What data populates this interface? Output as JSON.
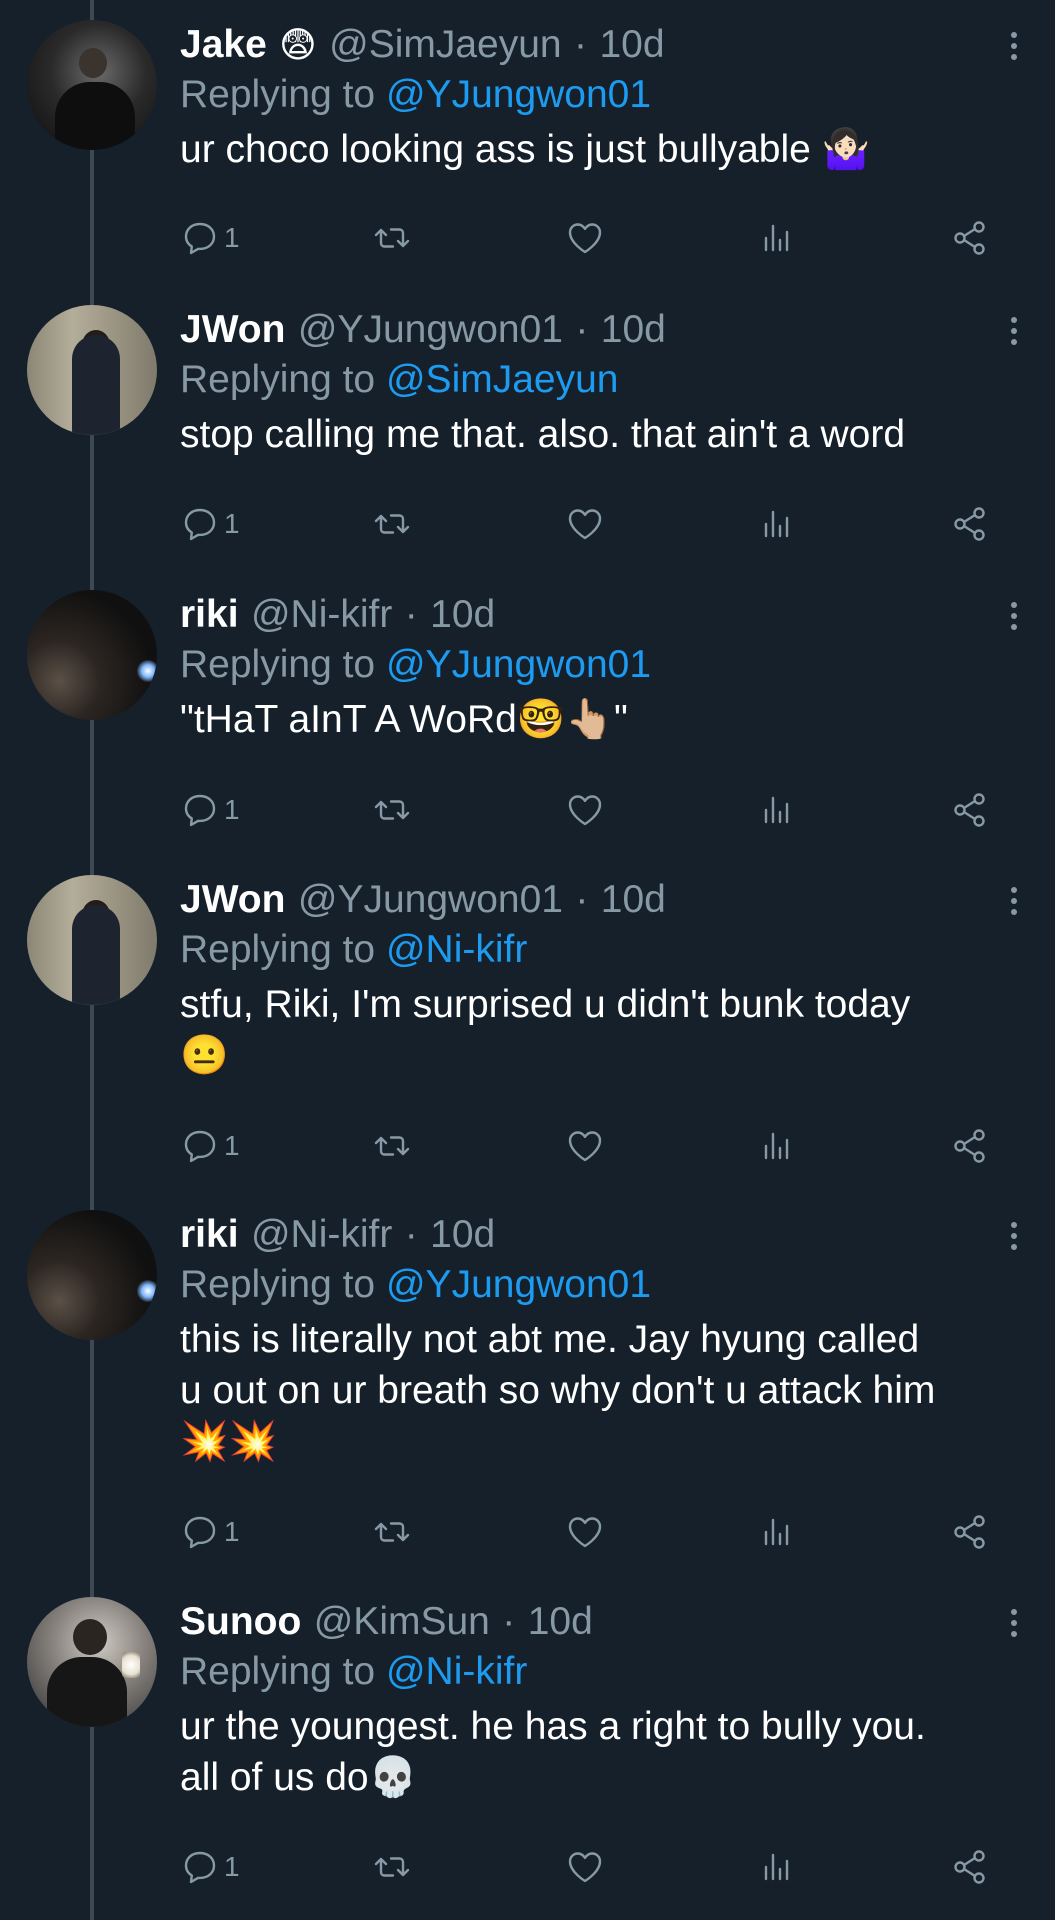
{
  "tweets": [
    {
      "name": "Jake",
      "name_emoji": "😨",
      "handle": "@SimJaeyun",
      "dot": "·",
      "time": "10d",
      "replying_label": "Replying to",
      "replying_to": "@YJungwon01",
      "text": "ur choco looking ass is just bullyable 🤷🏻‍♀️",
      "reply_count": "1",
      "avatar": "jake-avatar"
    },
    {
      "name": "JWon",
      "name_emoji": "",
      "handle": "@YJungwon01",
      "dot": "·",
      "time": "10d",
      "replying_label": "Replying to",
      "replying_to": "@SimJaeyun",
      "text": "stop calling me that. also. that ain't a word",
      "reply_count": "1",
      "avatar": "jwon-avatar"
    },
    {
      "name": "riki",
      "name_emoji": "",
      "handle": "@Ni-kifr",
      "dot": "·",
      "time": "10d",
      "replying_label": "Replying to",
      "replying_to": "@YJungwon01",
      "text": "\"tHaT aInT A WoRd🤓👆🏼\"",
      "reply_count": "1",
      "avatar": "riki-avatar"
    },
    {
      "name": "JWon",
      "name_emoji": "",
      "handle": "@YJungwon01",
      "dot": "·",
      "time": "10d",
      "replying_label": "Replying to",
      "replying_to": "@Ni-kifr",
      "text": "stfu, Riki, I'm surprised u didn't bunk today\n😐",
      "reply_count": "1",
      "avatar": "jwon-avatar"
    },
    {
      "name": "riki",
      "name_emoji": "",
      "handle": "@Ni-kifr",
      "dot": "·",
      "time": "10d",
      "replying_label": "Replying to",
      "replying_to": "@YJungwon01",
      "text": "this is literally not abt me. Jay hyung called\nu out on ur breath so why don't u attack him\n💥💥",
      "reply_count": "1",
      "avatar": "riki-avatar"
    },
    {
      "name": "Sunoo",
      "name_emoji": "",
      "handle": "@KimSun",
      "dot": "·",
      "time": "10d",
      "replying_label": "Replying to",
      "replying_to": "@Ni-kifr",
      "text": "ur the youngest. he has a right to bully you.\nall of us do💀",
      "reply_count": "1",
      "avatar": "sunoo-avatar"
    }
  ],
  "icons": {
    "reply": "reply-icon",
    "retweet": "retweet-icon",
    "like": "heart-icon",
    "views": "analytics-icon",
    "share": "share-icon",
    "more": "more-vertical-icon"
  },
  "colors": {
    "background": "#15202b",
    "text": "#ffffff",
    "secondary": "#8899a6",
    "mention": "#1d9bf0",
    "thread_line": "#3d4a56"
  }
}
